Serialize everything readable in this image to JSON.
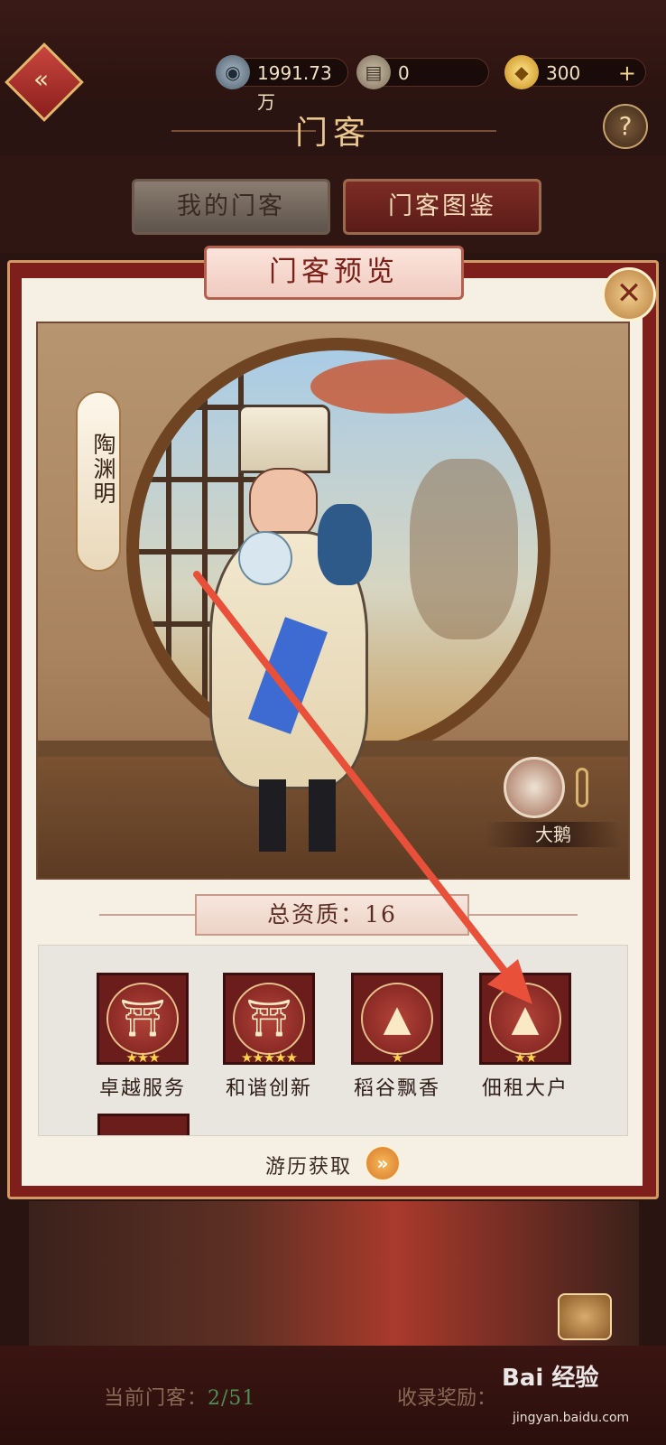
{
  "header": {
    "title": "门客",
    "currencies": [
      {
        "icon": "coin-icon",
        "value": "1991.73万"
      },
      {
        "icon": "scroll-icon",
        "value": "0"
      },
      {
        "icon": "gold-ingot-icon",
        "value": "300"
      }
    ],
    "add_label": "+",
    "help_label": "?"
  },
  "tabs": [
    {
      "label": "我的门客",
      "active": false
    },
    {
      "label": "门客图鉴",
      "active": true
    }
  ],
  "modal": {
    "title": "门客预览",
    "close_label": "✕",
    "character": {
      "name": "陶渊明",
      "bond": {
        "label": "大鹅"
      }
    },
    "total_quality": "总资质：16",
    "skills": [
      {
        "name": "卓越服务",
        "stars": "★★★",
        "icon": "pavilion-icon"
      },
      {
        "name": "和谐创新",
        "stars": "★★★★★",
        "icon": "pavilion-icon"
      },
      {
        "name": "稻谷飘香",
        "stars": "★",
        "icon": "mountain-icon"
      },
      {
        "name": "佃租大户",
        "stars": "★★",
        "icon": "mountain-icon"
      }
    ],
    "acquire_label": "游历获取",
    "acquire_btn": "»"
  },
  "footer": {
    "current_label": "当前门客：",
    "current_value": "2/51",
    "reward_label": "收录奖励："
  },
  "watermark": {
    "brand": "Bai 经验",
    "url": "jingyan.baidu.com"
  },
  "colors": {
    "accent_red": "#7e1f1c",
    "gold": "#e9c78d",
    "paper": "#f6efe4",
    "star": "#ffd24a",
    "arrow": "#e8503a"
  }
}
